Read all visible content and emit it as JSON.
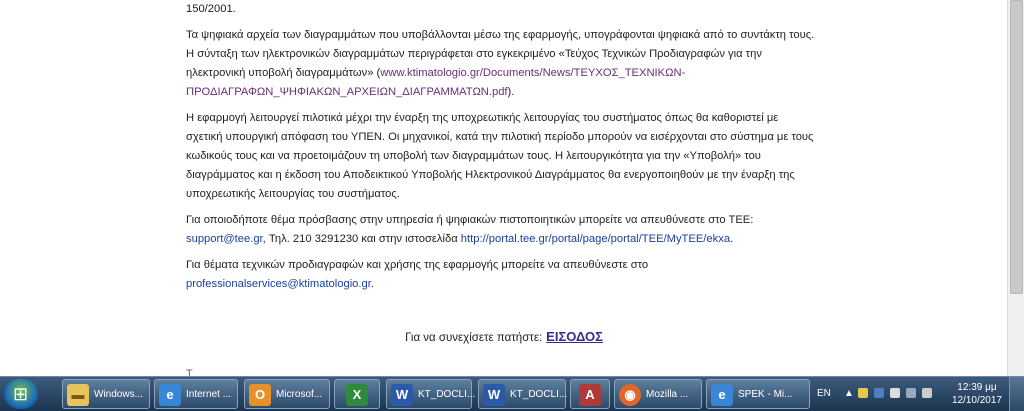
{
  "content": {
    "p0_tail": "150/2001.",
    "p1": {
      "l1": "Τα ψηφιακά αρχεία των διαγραμμάτων που υποβάλλονται μέσω της εφαρμογής, υπογράφονται ψηφιακά από το συντάκτη τους.",
      "l2": "Η σύνταξη των ηλεκτρονικών διαγραμμάτων περιγράφεται στο εγκεκριμένο «Τεύχος Τεχνικών Προδιαγραφών για την",
      "l3_text": "ηλεκτρονική υποβολή διαγραμμάτων» (",
      "l3_link": "www.ktimatologio.gr/Documents/News/ΤΕΥΧΟΣ_ΤΕΧΝΙΚΩΝ-",
      "l4_link": "ΠΡΟΔΙΑΓΡΑΦΩΝ_ΨΗΦΙΑΚΩΝ_ΑΡΧΕΙΩΝ_ΔΙΑΓΡΑΜΜΑΤΩΝ.pdf",
      "l4_tail": ")."
    },
    "p2": {
      "l1": "Η εφαρμογή λειτουργεί πιλοτικά μέχρι την έναρξη της υποχρεωτικής λειτουργίας του συστήματος όπως θα καθοριστεί με",
      "l2": "σχετική υπουργική απόφαση του ΥΠΕΝ. Οι μηχανικοί, κατά την πιλοτική περίοδο μπορούν να εισέρχονται στο σύστημα με τους",
      "l3": "κωδικούς τους και να προετοιμάζουν τη υποβολή των διαγραμμάτων τους. Η λειτουργικότητα για την «Υποβολή» του",
      "l4": "διαγράμματος και η έκδοση του Αποδεικτικού Υποβολής Ηλεκτρονικού Διαγράμματος θα ενεργοποιηθούν με την έναρξη της",
      "l5": "υποχρεωτικής λειτουργίας του συστήματος."
    },
    "p3": {
      "l1": "Για οποιοδήποτε θέμα πρόσβασης στην υπηρεσία ή ψηφιακών πιστοποιητικών μπορείτε να απευθύνεστε στο ΤΕΕ:",
      "email": "support@tee.gr",
      "mid": ", Τηλ. 210 3291230 και στην ιστοσελίδα ",
      "url": "http://portal.tee.gr/portal/page/portal/TEE/MyTEE/ekxa",
      "tail": "."
    },
    "p4": {
      "l1": "Για θέματα τεχνικών προδιαγραφών και χρήσης της εφαρμογής μπορείτε να απευθύνεστε στο",
      "email": "professionalservices@ktimatologio.gr",
      "tail": "."
    },
    "continue_text": "Για να συνεχίσετε πατήστε:",
    "login_link": "ΕΙΣΟΔΟΣ"
  },
  "taskbar": {
    "items": [
      {
        "label": "Windows...",
        "icon": "folder-icon"
      },
      {
        "label": "Internet ...",
        "icon": "internet-explorer-icon"
      },
      {
        "label": "Microsof...",
        "icon": "outlook-icon"
      },
      {
        "label": "",
        "icon": "excel-icon"
      },
      {
        "label": "KT_DOCLI...",
        "icon": "word-icon"
      },
      {
        "label": "KT_DOCLI...",
        "icon": "word-icon"
      },
      {
        "label": "",
        "icon": "access-icon"
      },
      {
        "label": "Mozilla ...",
        "icon": "firefox-icon"
      },
      {
        "label": "SPEK - Mi...",
        "icon": "internet-explorer-icon"
      }
    ],
    "lang": "EN",
    "time": "12:39 μμ",
    "date": "12/10/2017"
  },
  "colors": {
    "link": "#1a3fa0",
    "visited_link": "#6b2d7a",
    "taskbar": "#2c4a69"
  }
}
